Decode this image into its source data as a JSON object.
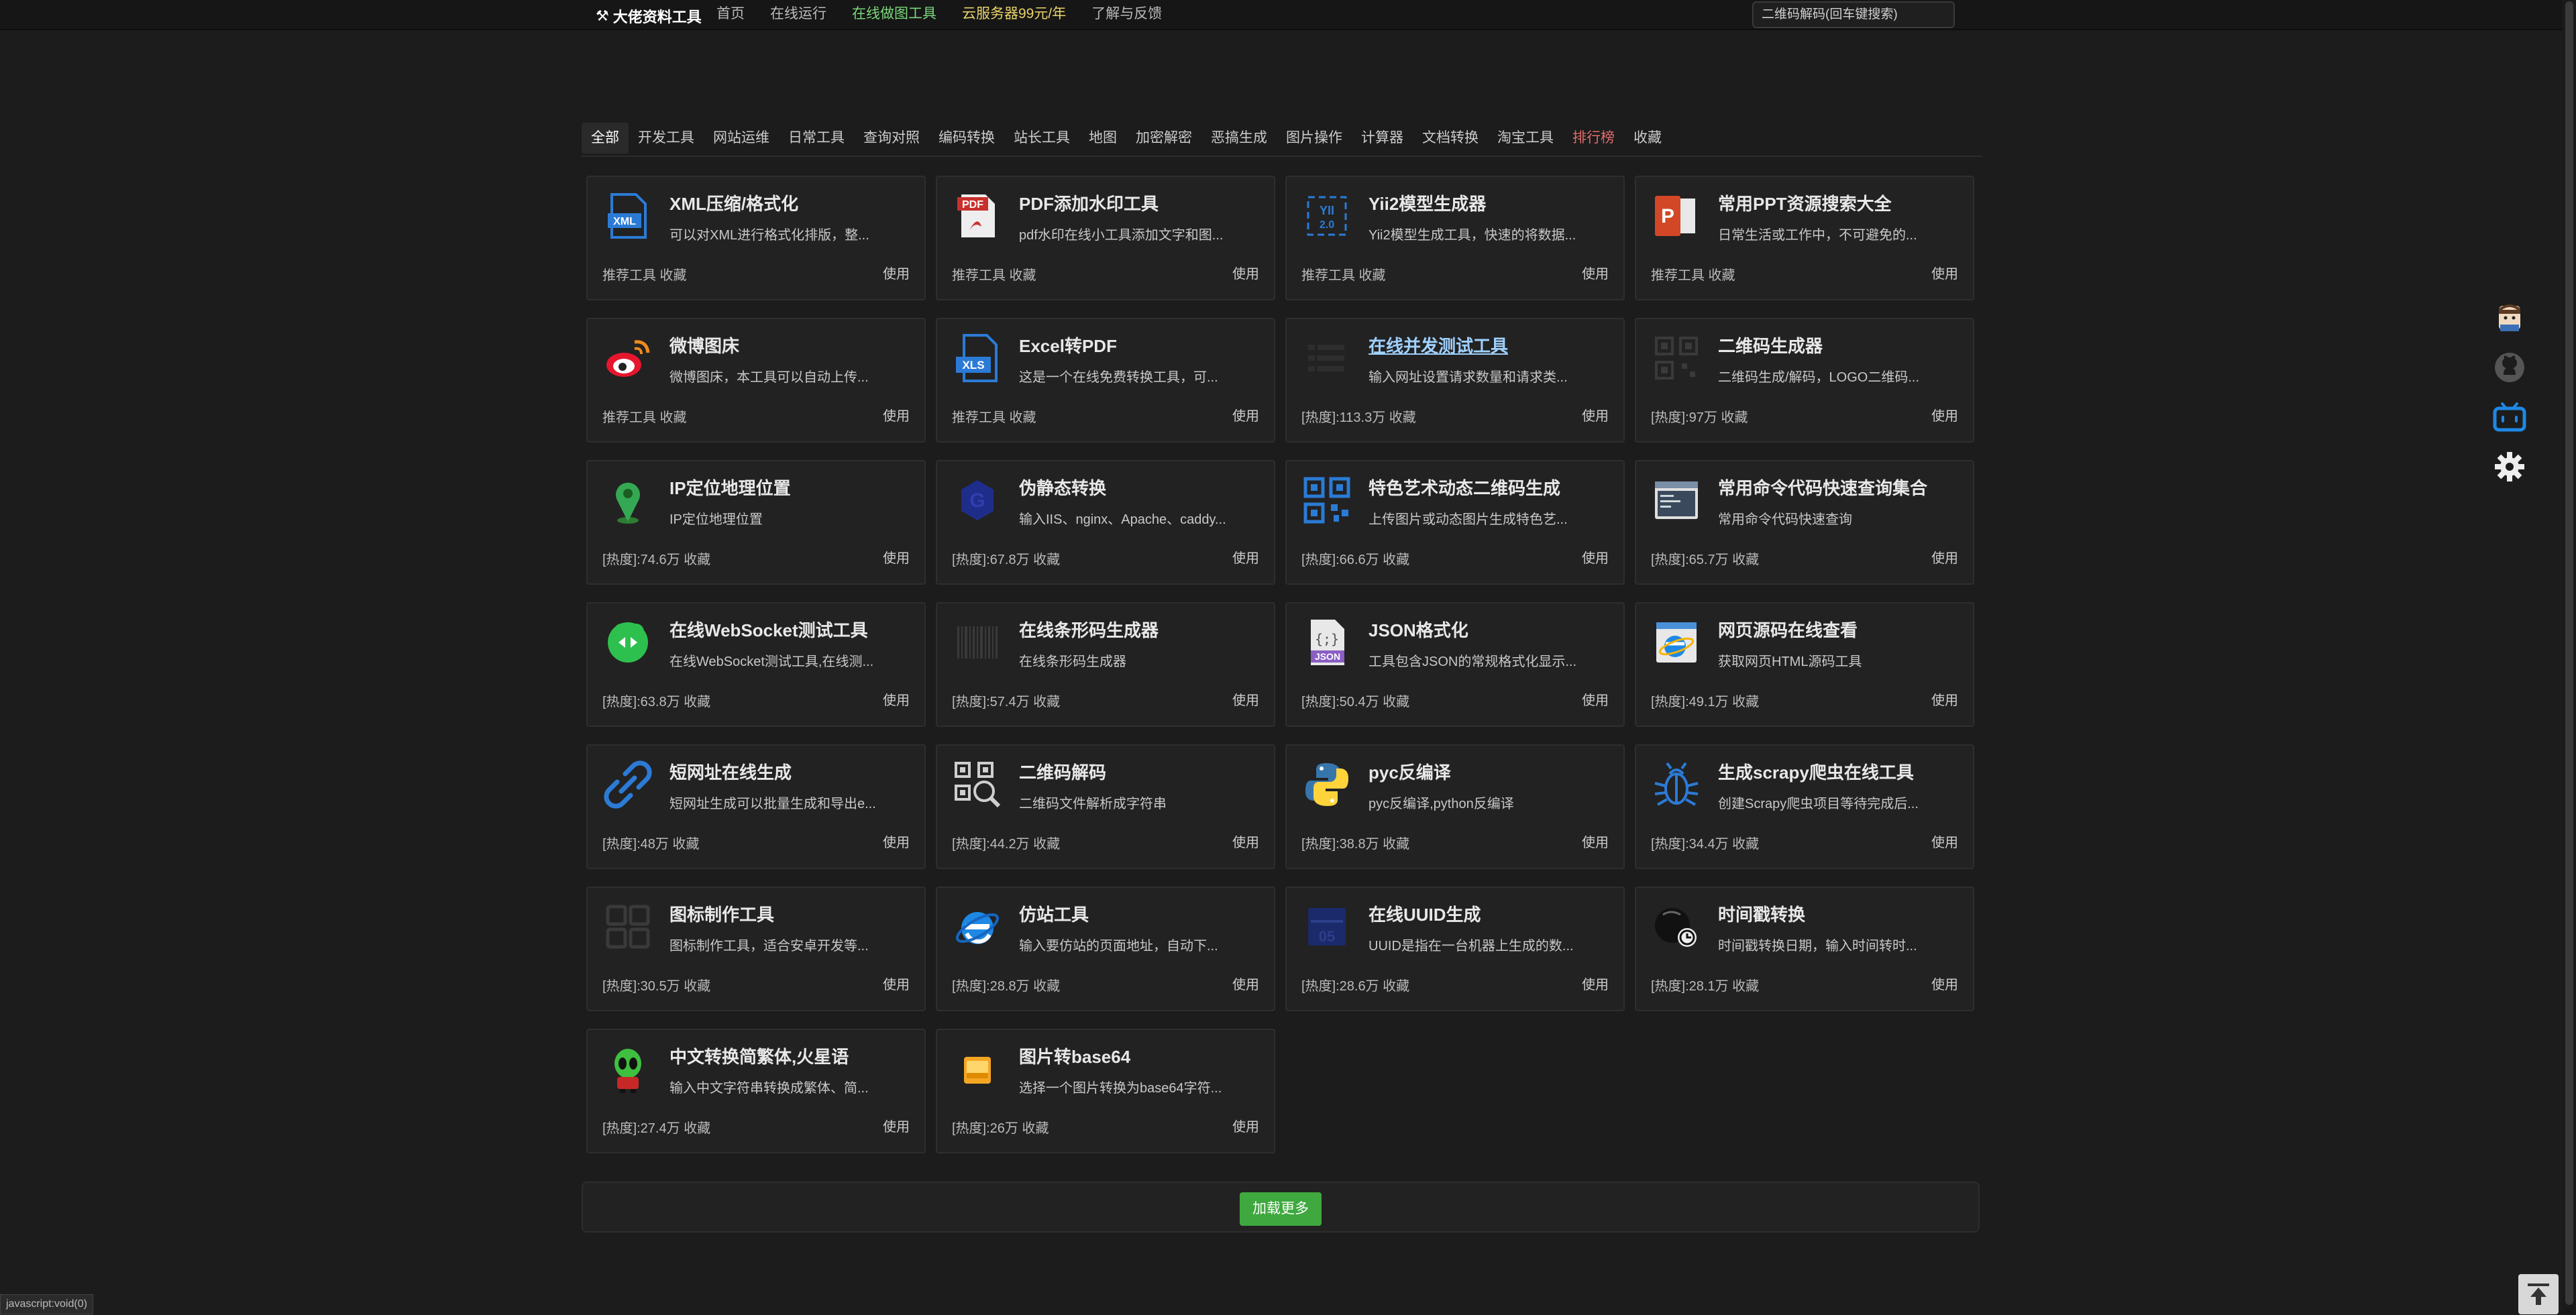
{
  "brand": {
    "name": "大佬资料工具"
  },
  "nav": [
    {
      "label": "首页",
      "style": "normal"
    },
    {
      "label": "在线运行",
      "style": "normal"
    },
    {
      "label": "在线做图工具",
      "style": "green"
    },
    {
      "label": "云服务器99元/年",
      "style": "yellow"
    },
    {
      "label": "了解与反馈",
      "style": "normal"
    }
  ],
  "search": {
    "placeholder": "二维码解码(回车键搜索)"
  },
  "categories": [
    {
      "label": "全部",
      "active": true
    },
    {
      "label": "开发工具"
    },
    {
      "label": "网站运维"
    },
    {
      "label": "日常工具"
    },
    {
      "label": "查询对照"
    },
    {
      "label": "编码转换"
    },
    {
      "label": "站长工具"
    },
    {
      "label": "地图"
    },
    {
      "label": "加密解密"
    },
    {
      "label": "恶搞生成"
    },
    {
      "label": "图片操作"
    },
    {
      "label": "计算器"
    },
    {
      "label": "文档转换"
    },
    {
      "label": "淘宝工具"
    },
    {
      "label": "排行榜",
      "red": true
    },
    {
      "label": "收藏"
    }
  ],
  "cards": [
    {
      "title": "XML压缩/格式化",
      "desc": "可以对XML进行格式化排版，整...",
      "meta": "推荐工具 收藏",
      "use": "使用",
      "icon": "xml-file-icon"
    },
    {
      "title": "PDF添加水印工具",
      "desc": "pdf水印在线小工具添加文字和图...",
      "meta": "推荐工具 收藏",
      "use": "使用",
      "icon": "pdf-icon"
    },
    {
      "title": "Yii2模型生成器",
      "desc": "Yii2模型生成工具，快速的将数据...",
      "meta": "推荐工具 收藏",
      "use": "使用",
      "icon": "yii2-icon"
    },
    {
      "title": "常用PPT资源搜索大全",
      "desc": "日常生活或工作中，不可避免的...",
      "meta": "推荐工具 收藏",
      "use": "使用",
      "icon": "ppt-icon"
    },
    {
      "title": "微博图床",
      "desc": "微博图床，本工具可以自动上传...",
      "meta": "推荐工具 收藏",
      "use": "使用",
      "icon": "weibo-icon"
    },
    {
      "title": "Excel转PDF",
      "desc": "这是一个在线免费转换工具，可...",
      "meta": "推荐工具 收藏",
      "use": "使用",
      "icon": "xls-file-icon"
    },
    {
      "title": "在线并发测试工具",
      "desc": "输入网址设置请求数量和请求类...",
      "meta": "[热度]:113.3万 收藏",
      "use": "使用",
      "icon": "concurrency-test-icon",
      "link": true
    },
    {
      "title": "二维码生成器",
      "desc": "二维码生成/解码，LOGO二维码...",
      "meta": "[热度]:97万 收藏",
      "use": "使用",
      "icon": "qr-generator-icon"
    },
    {
      "title": "IP定位地理位置",
      "desc": "IP定位地理位置",
      "meta": "[热度]:74.6万 收藏",
      "use": "使用",
      "icon": "map-pin-icon"
    },
    {
      "title": "伪静态转换",
      "desc": "输入IIS、nginx、Apache、caddy...",
      "meta": "[热度]:67.8万 收藏",
      "use": "使用",
      "icon": "rewrite-icon"
    },
    {
      "title": "特色艺术动态二维码生成",
      "desc": "上传图片或动态图片生成特色艺...",
      "meta": "[热度]:66.6万 收藏",
      "use": "使用",
      "icon": "qr-code-icon"
    },
    {
      "title": "常用命令代码快速查询集合",
      "desc": "常用命令代码快速查询",
      "meta": "[热度]:65.7万 收藏",
      "use": "使用",
      "icon": "terminal-icon"
    },
    {
      "title": "在线WebSocket测试工具",
      "desc": "在线WebSocket测试工具,在线测...",
      "meta": "[热度]:63.8万 收藏",
      "use": "使用",
      "icon": "websocket-icon"
    },
    {
      "title": "在线条形码生成器",
      "desc": "在线条形码生成器",
      "meta": "[热度]:57.4万 收藏",
      "use": "使用",
      "icon": "barcode-icon"
    },
    {
      "title": "JSON格式化",
      "desc": "工具包含JSON的常规格式化显示...",
      "meta": "[热度]:50.4万 收藏",
      "use": "使用",
      "icon": "json-file-icon"
    },
    {
      "title": "网页源码在线查看",
      "desc": "获取网页HTML源码工具",
      "meta": "[热度]:49.1万 收藏",
      "use": "使用",
      "icon": "ie-window-icon"
    },
    {
      "title": "短网址在线生成",
      "desc": "短网址生成可以批量生成和导出e...",
      "meta": "[热度]:48万 收藏",
      "use": "使用",
      "icon": "link-icon"
    },
    {
      "title": "二维码解码",
      "desc": "二维码文件解析成字符串",
      "meta": "[热度]:44.2万 收藏",
      "use": "使用",
      "icon": "qr-search-icon"
    },
    {
      "title": "pyc反编译",
      "desc": "pyc反编译,python反编译",
      "meta": "[热度]:38.8万 收藏",
      "use": "使用",
      "icon": "python-icon"
    },
    {
      "title": "生成scrapy爬虫在线工具",
      "desc": "创建Scrapy爬虫项目等待完成后...",
      "meta": "[热度]:34.4万 收藏",
      "use": "使用",
      "icon": "bug-icon"
    },
    {
      "title": "图标制作工具",
      "desc": "图标制作工具，适合安卓开发等...",
      "meta": "[热度]:30.5万 收藏",
      "use": "使用",
      "icon": "grid-icon"
    },
    {
      "title": "仿站工具",
      "desc": "输入要仿站的页面地址，自动下...",
      "meta": "[热度]:28.8万 收藏",
      "use": "使用",
      "icon": "ie-icon"
    },
    {
      "title": "在线UUID生成",
      "desc": "UUID是指在一台机器上生成的数...",
      "meta": "[热度]:28.6万 收藏",
      "use": "使用",
      "icon": "uuid-icon"
    },
    {
      "title": "时间戳转换",
      "desc": "时间戳转换日期，输入时间转时...",
      "meta": "[热度]:28.1万 收藏",
      "use": "使用",
      "icon": "clock-icon"
    },
    {
      "title": "中文转换简繁体,火星语",
      "desc": "输入中文字符串转换成繁体、简...",
      "meta": "[热度]:27.4万 收藏",
      "use": "使用",
      "icon": "alien-icon"
    },
    {
      "title": "图片转base64",
      "desc": "选择一个图片转换为base64字符...",
      "meta": "[热度]:26万 收藏",
      "use": "使用",
      "icon": "image-icon"
    }
  ],
  "load_more": "加载更多",
  "status_bar": "javascript:void(0)",
  "sidebar": [
    "avatar-icon",
    "github-icon",
    "bilibili-icon",
    "settings-icon"
  ],
  "colors": {
    "accent_green": "#3fa83f",
    "nav_green": "#7bd87b",
    "nav_yellow": "#e8d36b",
    "tab_red": "#e06c6c",
    "bg": "#1c1c1c",
    "card_bg": "#222222"
  }
}
